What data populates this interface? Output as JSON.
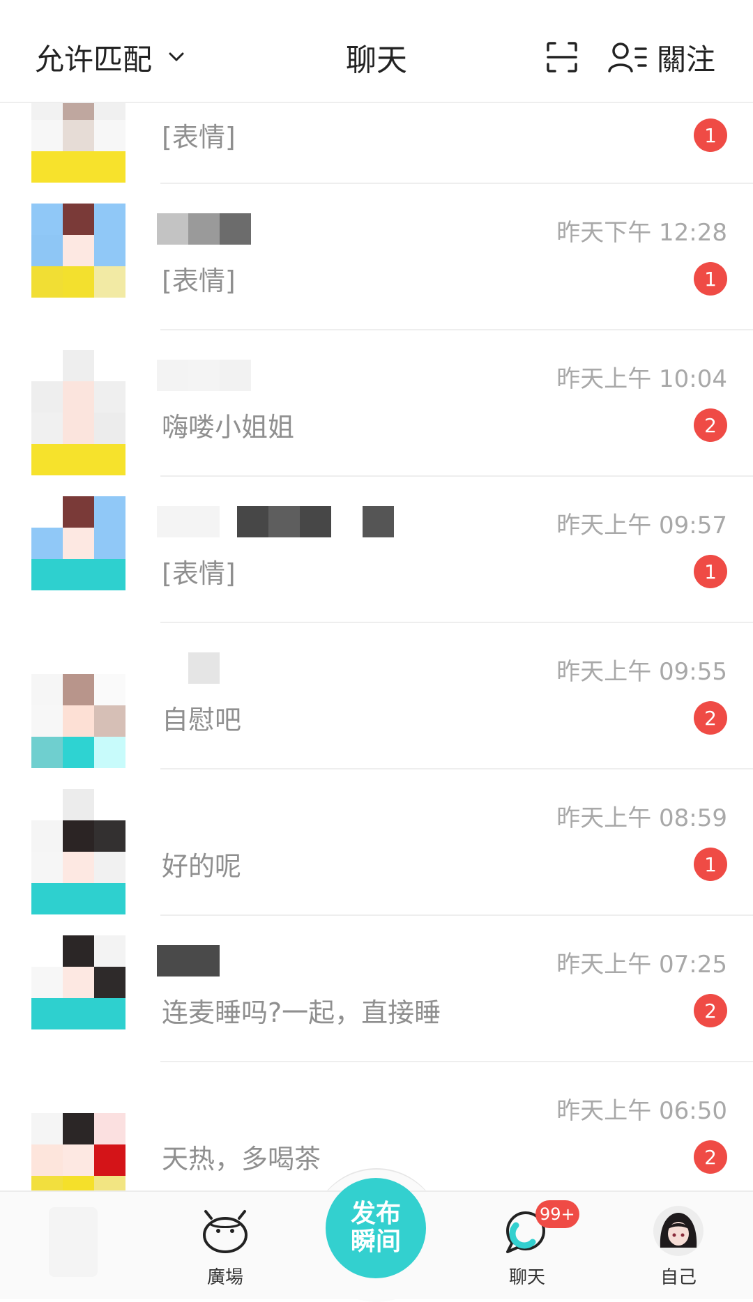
{
  "header": {
    "match_filter_label": "允许匹配",
    "title": "聊天",
    "follow_label": "關注",
    "icons": [
      "chevron-down-icon",
      "scan-icon",
      "follow-list-icon"
    ]
  },
  "chats": [
    {
      "time": "",
      "preview": "[表情]",
      "unread": "1"
    },
    {
      "time": "昨天下午 12:28",
      "preview": "[表情]",
      "unread": "1"
    },
    {
      "time": "昨天上午 10:04",
      "preview": "嗨喽小姐姐",
      "unread": "2"
    },
    {
      "time": "昨天上午 09:57",
      "preview": "[表情]",
      "unread": "1"
    },
    {
      "time": "昨天上午 09:55",
      "preview": "自慰吧",
      "unread": "2"
    },
    {
      "time": "昨天上午 08:59",
      "preview": "好的呢",
      "unread": "1"
    },
    {
      "time": "昨天上午 07:25",
      "preview": "连麦睡吗?一起，直接睡",
      "unread": "2"
    },
    {
      "time": "昨天上午 06:50",
      "preview": "天热，多喝茶",
      "unread": "2"
    }
  ],
  "bottom_nav": {
    "square_label": "廣場",
    "publish_line1": "发布",
    "publish_line2": "瞬间",
    "chat_label": "聊天",
    "chat_badge": "99+",
    "me_label": "自己"
  },
  "colors": {
    "accent": "#33d0cf",
    "badge": "#ef4b45",
    "muted_text": "#a8a8a8"
  }
}
